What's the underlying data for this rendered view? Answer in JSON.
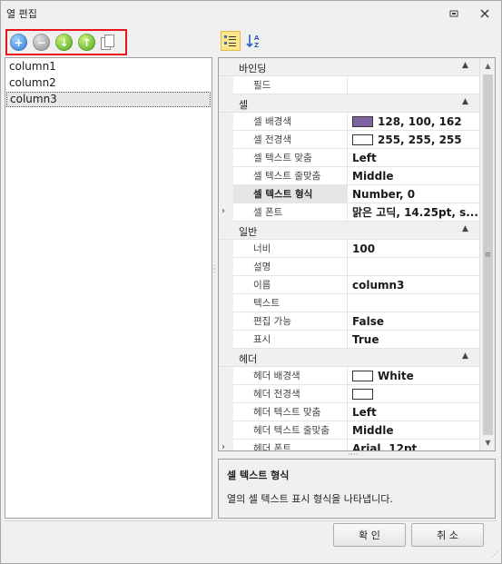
{
  "window": {
    "title": "열 편집"
  },
  "toolbar": {
    "add": "+",
    "remove": "−",
    "down": "↓",
    "up": "↑"
  },
  "columns": [
    "column1",
    "column2",
    "column3"
  ],
  "grid": {
    "categories": {
      "binding": "바인딩",
      "cell": "셀",
      "general": "일반",
      "header": "헤더"
    },
    "binding": [
      {
        "name": "필드",
        "value": ""
      }
    ],
    "cell": [
      {
        "name": "셀 배경색",
        "value": "128, 100, 162",
        "swatch": "#8064a2"
      },
      {
        "name": "셀 전경색",
        "value": "255, 255, 255",
        "swatch": "#ffffff"
      },
      {
        "name": "셀 텍스트 맞춤",
        "value": "Left"
      },
      {
        "name": "셀 텍스트 줄맞춤",
        "value": "Middle"
      },
      {
        "name": "셀 텍스트 형식",
        "value": "Number, 0"
      },
      {
        "name": "셀 폰트",
        "value": "맑은 고딕, 14.25pt, s..."
      }
    ],
    "general": [
      {
        "name": "너비",
        "value": "100"
      },
      {
        "name": "설명",
        "value": ""
      },
      {
        "name": "이름",
        "value": "column3"
      },
      {
        "name": "텍스트",
        "value": ""
      },
      {
        "name": "편집 가능",
        "value": "False"
      },
      {
        "name": "표시",
        "value": "True"
      }
    ],
    "header": [
      {
        "name": "헤더 배경색",
        "value": "White",
        "swatch": "#ffffff"
      },
      {
        "name": "헤더 전경색",
        "value": "",
        "swatch": "#ffffff"
      },
      {
        "name": "헤더 텍스트 맞춤",
        "value": "Left"
      },
      {
        "name": "헤더 텍스트 줄맞춤",
        "value": "Middle"
      },
      {
        "name": "헤더 폰트",
        "value": "Arial, 12pt"
      }
    ]
  },
  "description": {
    "title": "셀 텍스트 형식",
    "text": "열의 셀 텍스트 표시 형식을 나타냅니다."
  },
  "buttons": {
    "ok": "확 인",
    "cancel": "취 소"
  }
}
